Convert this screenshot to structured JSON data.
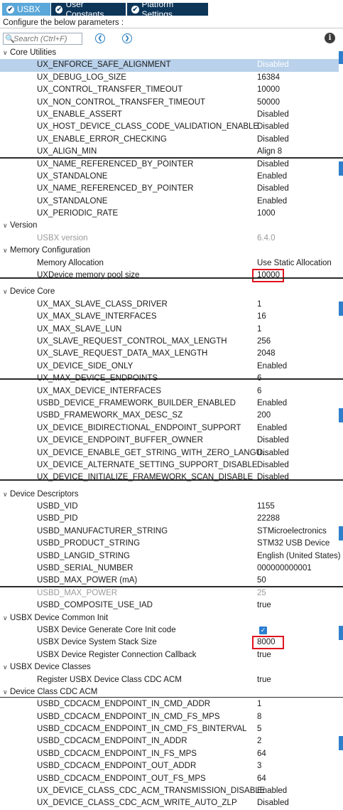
{
  "tabs": [
    {
      "label": "USBX"
    },
    {
      "label": "User Constants"
    },
    {
      "label": "Platform Settings"
    }
  ],
  "configure_text": "Configure the below parameters :",
  "search": {
    "placeholder": "Search (Ctrl+F)"
  },
  "colors": {
    "accent_tab": "#5aa7d9",
    "dark_tab": "#0c3558",
    "selection": "#b9d1ea",
    "highlight_box": "#e0141e"
  },
  "rows": [
    {
      "type": "cat",
      "name": "Core Utilities"
    },
    {
      "name": "UX_ENFORCE_SAFE_ALIGNMENT",
      "value": "Disabled",
      "selected": true
    },
    {
      "name": "UX_DEBUG_LOG_SIZE",
      "value": "16384"
    },
    {
      "name": "UX_CONTROL_TRANSFER_TIMEOUT",
      "value": "10000"
    },
    {
      "name": "UX_NON_CONTROL_TRANSFER_TIMEOUT",
      "value": "50000"
    },
    {
      "name": "UX_ENABLE_ASSERT",
      "value": "Disabled"
    },
    {
      "name": "UX_HOST_DEVICE_CLASS_CODE_VALIDATION_ENABLE",
      "value": "Disabled"
    },
    {
      "name": "UX_ENABLE_ERROR_CHECKING",
      "value": "Disabled"
    },
    {
      "name": "UX_ALIGN_MIN",
      "value": "Align 8"
    },
    {
      "name": "UX_NAME_REFERENCED_BY_POINTER",
      "value": "Disabled"
    },
    {
      "name": "UX_STANDALONE",
      "value": "Enabled"
    },
    {
      "name": "UX_NAME_REFERENCED_BY_POINTER",
      "value": "Disabled"
    },
    {
      "name": "UX_STANDALONE",
      "value": "Enabled"
    },
    {
      "name": "UX_PERIODIC_RATE",
      "value": "1000"
    },
    {
      "type": "cat",
      "name": "Version"
    },
    {
      "name": "USBX version",
      "value": "6.4.0",
      "dim": true
    },
    {
      "type": "cat",
      "name": "Memory Configuration"
    },
    {
      "name": "Memory Allocation",
      "value": "Use Static Allocation"
    },
    {
      "name": "UXDevice memory pool size",
      "value": "10000",
      "boxed": true
    },
    {
      "type": "cut"
    },
    {
      "type": "cat",
      "name": "Device Core"
    },
    {
      "name": "UX_MAX_SLAVE_CLASS_DRIVER",
      "value": "1"
    },
    {
      "name": "UX_MAX_SLAVE_INTERFACES",
      "value": "16"
    },
    {
      "name": "UX_MAX_SLAVE_LUN",
      "value": "1"
    },
    {
      "name": "UX_SLAVE_REQUEST_CONTROL_MAX_LENGTH",
      "value": "256"
    },
    {
      "name": "UX_SLAVE_REQUEST_DATA_MAX_LENGTH",
      "value": "2048"
    },
    {
      "name": "UX_DEVICE_SIDE_ONLY",
      "value": "Enabled"
    },
    {
      "name": "UX_MAX_DEVICE_ENDPOINTS",
      "value": "6"
    },
    {
      "name": "UX_MAX_DEVICE_INTERFACES",
      "value": "6"
    },
    {
      "name": "USBD_DEVICE_FRAMEWORK_BUILDER_ENABLED",
      "value": "Enabled"
    },
    {
      "name": "USBD_FRAMEWORK_MAX_DESC_SZ",
      "value": "200"
    },
    {
      "name": "UX_DEVICE_BIDIRECTIONAL_ENDPOINT_SUPPORT",
      "value": "Enabled"
    },
    {
      "name": "UX_DEVICE_ENDPOINT_BUFFER_OWNER",
      "value": "Disabled"
    },
    {
      "name": "UX_DEVICE_ENABLE_GET_STRING_WITH_ZERO_LANGU...",
      "value": "Disabled"
    },
    {
      "name": "UX_DEVICE_ALTERNATE_SETTING_SUPPORT_DISABLE",
      "value": "Disabled"
    },
    {
      "name": "UX_DEVICE_INITIALIZE_FRAMEWORK_SCAN_DISABLE",
      "value": "Disabled"
    },
    {
      "type": "cut"
    },
    {
      "type": "cat",
      "name": "Device Descriptors"
    },
    {
      "name": "USBD_VID",
      "value": "1155"
    },
    {
      "name": "USBD_PID",
      "value": "22288"
    },
    {
      "name": "USBD_MANUFACTURER_STRING",
      "value": "STMicroelectronics"
    },
    {
      "name": "USBD_PRODUCT_STRING",
      "value": "STM32 USB Device"
    },
    {
      "name": "USBD_LANGID_STRING",
      "value": "English (United States)"
    },
    {
      "name": "USBD_SERIAL_NUMBER",
      "value": "000000000001"
    },
    {
      "name": "USBD_MAX_POWER (mA)",
      "value": "50"
    },
    {
      "name": "USBD_MAX_POWER",
      "value": "25",
      "dim": true
    },
    {
      "name": "USBD_COMPOSITE_USE_IAD",
      "value": "true"
    },
    {
      "type": "cat",
      "name": "USBX Device Common Init"
    },
    {
      "name": "USBX Device Generate Core Init code",
      "value": "",
      "checkbox": true
    },
    {
      "name": "USBX Device System Stack Size",
      "value": "8000",
      "boxed": true
    },
    {
      "name": "USBX Device Register Connection Callback",
      "value": "true"
    },
    {
      "type": "cat",
      "name": "USBX Device Classes"
    },
    {
      "name": "Register USBX Device Class CDC ACM",
      "value": "true"
    },
    {
      "type": "cat",
      "name": "Device Class CDC ACM"
    },
    {
      "name": "USBD_CDCACM_ENDPOINT_IN_CMD_ADDR",
      "value": "1"
    },
    {
      "name": "USBD_CDCACM_ENDPOINT_IN_CMD_FS_MPS",
      "value": "8"
    },
    {
      "name": "USBD_CDCACM_ENDPOINT_IN_CMD_FS_BINTERVAL",
      "value": "5"
    },
    {
      "name": "USBD_CDCACM_ENDPOINT_IN_ADDR",
      "value": "2"
    },
    {
      "name": "USBD_CDCACM_ENDPOINT_IN_FS_MPS",
      "value": "64"
    },
    {
      "name": "USBD_CDCACM_ENDPOINT_OUT_ADDR",
      "value": "3"
    },
    {
      "name": "USBD_CDCACM_ENDPOINT_OUT_FS_MPS",
      "value": "64"
    },
    {
      "name": "UX_DEVICE_CLASS_CDC_ACM_TRANSMISSION_DISABLE",
      "value": "Enabled"
    },
    {
      "name": "UX_DEVICE_CLASS_CDC_ACM_WRITE_AUTO_ZLP",
      "value": "Disabled"
    }
  ]
}
